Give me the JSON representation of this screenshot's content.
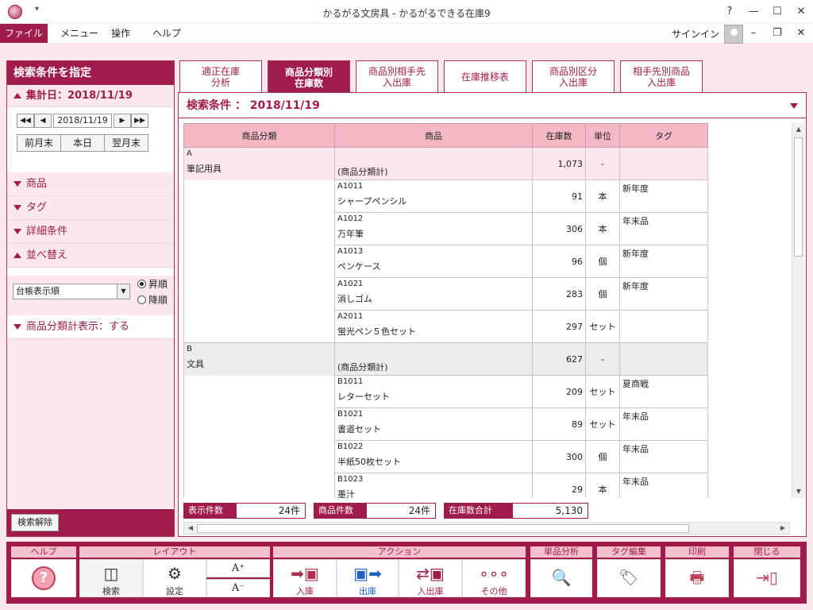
{
  "window": {
    "title": "かるがる文房具 - かるがるできる在庫9",
    "qat": "▾",
    "help": "?",
    "minimize": "—",
    "maximize": "☐",
    "close": "✕"
  },
  "menu": {
    "file": "ファイル",
    "items": [
      "メニュー",
      "操作",
      "ヘルプ"
    ],
    "signin": "サインイン",
    "ribbon_min": "–",
    "restore": "❐",
    "close": "✕"
  },
  "left": {
    "header": "検索条件を指定",
    "date_section": "集計日：2018/11/19",
    "date_value": "2018/11/19",
    "nav": {
      "first": "◀◀",
      "prev": "◀",
      "next": "▶",
      "last": "▶▶"
    },
    "prev_month": "前月末",
    "today": "本日",
    "next_month": "翌月末",
    "sections": [
      "商品",
      "タグ",
      "詳細条件"
    ],
    "sort_section": "並べ替え",
    "sort_value": "台帳表示順",
    "asc": "昇順",
    "desc": "降順",
    "subtotal_section": "商品分類計表示：する",
    "clear": "検索解除"
  },
  "tabs": [
    {
      "label": "適正在庫\n分析"
    },
    {
      "label": "商品分類別\n在庫数"
    },
    {
      "label": "商品別相手先\n入出庫"
    },
    {
      "label": "在庫推移表"
    },
    {
      "label": "商品別区分\n入出庫"
    },
    {
      "label": "相手先別商品\n入出庫"
    }
  ],
  "criteria": "検索条件 ： 2018/11/19",
  "grid": {
    "headers": [
      "商品分類",
      "商品",
      "在庫数",
      "単位",
      "タグ"
    ],
    "subtotal_label": "(商品分類計)",
    "groups": [
      {
        "code": "A",
        "name": "筆記用具",
        "subtotal": "1,073",
        "subunit": "-",
        "items": [
          {
            "code": "A1011",
            "name": "シャープペンシル",
            "qty": "91",
            "unit": "本",
            "tag": "新年度"
          },
          {
            "code": "A1012",
            "name": "万年筆",
            "qty": "306",
            "unit": "本",
            "tag": "年末品"
          },
          {
            "code": "A1013",
            "name": "ペンケース",
            "qty": "96",
            "unit": "個",
            "tag": "新年度"
          },
          {
            "code": "A1021",
            "name": "消しゴム",
            "qty": "283",
            "unit": "個",
            "tag": "新年度"
          },
          {
            "code": "A2011",
            "name": "蛍光ペン５色セット",
            "qty": "297",
            "unit": "セット",
            "tag": ""
          }
        ]
      },
      {
        "code": "B",
        "name": "文具",
        "subtotal": "627",
        "subunit": "-",
        "items": [
          {
            "code": "B1011",
            "name": "レターセット",
            "qty": "209",
            "unit": "セット",
            "tag": "夏商戦"
          },
          {
            "code": "B1021",
            "name": "書道セット",
            "qty": "89",
            "unit": "セット",
            "tag": "年末品"
          },
          {
            "code": "B1022",
            "name": "半紙50枚セット",
            "qty": "300",
            "unit": "個",
            "tag": "年末品"
          },
          {
            "code": "B1023",
            "name": "墨汁",
            "qty": "29",
            "unit": "本",
            "tag": "年末品"
          }
        ]
      }
    ]
  },
  "summary": {
    "display_label": "表示件数",
    "display_value": "24件",
    "items_label": "商品件数",
    "items_value": "24件",
    "total_label": "在庫数合計",
    "total_value": "5,130"
  },
  "toolbar": {
    "help_group": "ヘルプ",
    "help_icon": "?",
    "layout_group": "レイアウト",
    "search": "検索",
    "settings": "設定",
    "font_up": "A⁺",
    "font_down": "A⁻",
    "action_group": "アクション",
    "in": "入庫",
    "out": "出庫",
    "inout": "入出庫",
    "other": "その他",
    "analysis_group": "単品分析",
    "tag_group": "タグ編集",
    "print_group": "印刷",
    "close_group": "閉じる",
    "other_icon": "∘∘∘"
  }
}
